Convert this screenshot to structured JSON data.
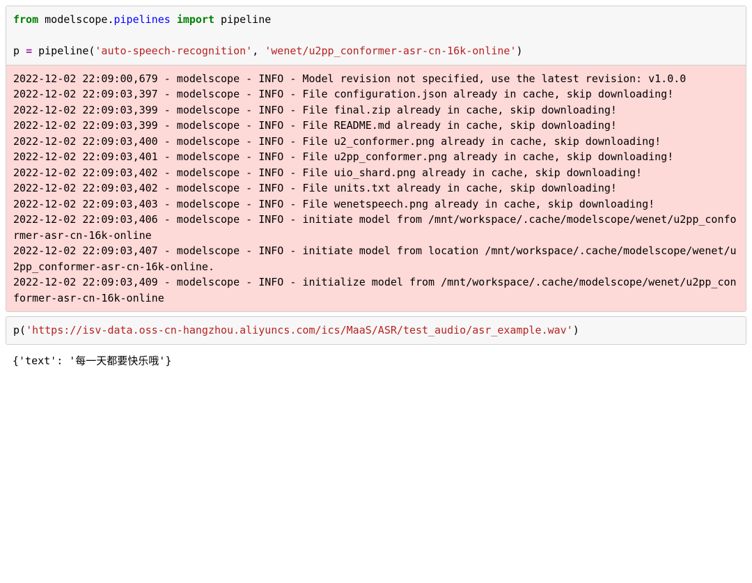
{
  "cell1": {
    "kw_from": "from",
    "mod_path": "modelscope.",
    "mod_sub": "pipelines",
    "kw_import": "import",
    "imp_name": "pipeline",
    "line2_pre": "p ",
    "op_eq": "=",
    "line2_call_open": " pipeline(",
    "str_task": "'auto-speech-recognition'",
    "sep": ", ",
    "str_model": "'wenet/u2pp_conformer-asr-cn-16k-online'",
    "line2_call_close": ")"
  },
  "stderr_text": "2022-12-02 22:09:00,679 - modelscope - INFO - Model revision not specified, use the latest revision: v1.0.0\n2022-12-02 22:09:03,397 - modelscope - INFO - File configuration.json already in cache, skip downloading!\n2022-12-02 22:09:03,399 - modelscope - INFO - File final.zip already in cache, skip downloading!\n2022-12-02 22:09:03,399 - modelscope - INFO - File README.md already in cache, skip downloading!\n2022-12-02 22:09:03,400 - modelscope - INFO - File u2_conformer.png already in cache, skip downloading!\n2022-12-02 22:09:03,401 - modelscope - INFO - File u2pp_conformer.png already in cache, skip downloading!\n2022-12-02 22:09:03,402 - modelscope - INFO - File uio_shard.png already in cache, skip downloading!\n2022-12-02 22:09:03,402 - modelscope - INFO - File units.txt already in cache, skip downloading!\n2022-12-02 22:09:03,403 - modelscope - INFO - File wenetspeech.png already in cache, skip downloading!\n2022-12-02 22:09:03,406 - modelscope - INFO - initiate model from /mnt/workspace/.cache/modelscope/wenet/u2pp_conformer-asr-cn-16k-online\n2022-12-02 22:09:03,407 - modelscope - INFO - initiate model from location /mnt/workspace/.cache/modelscope/wenet/u2pp_conformer-asr-cn-16k-online.\n2022-12-02 22:09:03,409 - modelscope - INFO - initialize model from /mnt/workspace/.cache/modelscope/wenet/u2pp_conformer-asr-cn-16k-online",
  "cell2": {
    "call_open": "p(",
    "str_url": "'https://isv-data.oss-cn-hangzhou.aliyuncs.com/ics/MaaS/ASR/test_audio/asr_example.wav'",
    "call_close": ")"
  },
  "output_text": "{'text': '每一天都要快乐哦'}"
}
